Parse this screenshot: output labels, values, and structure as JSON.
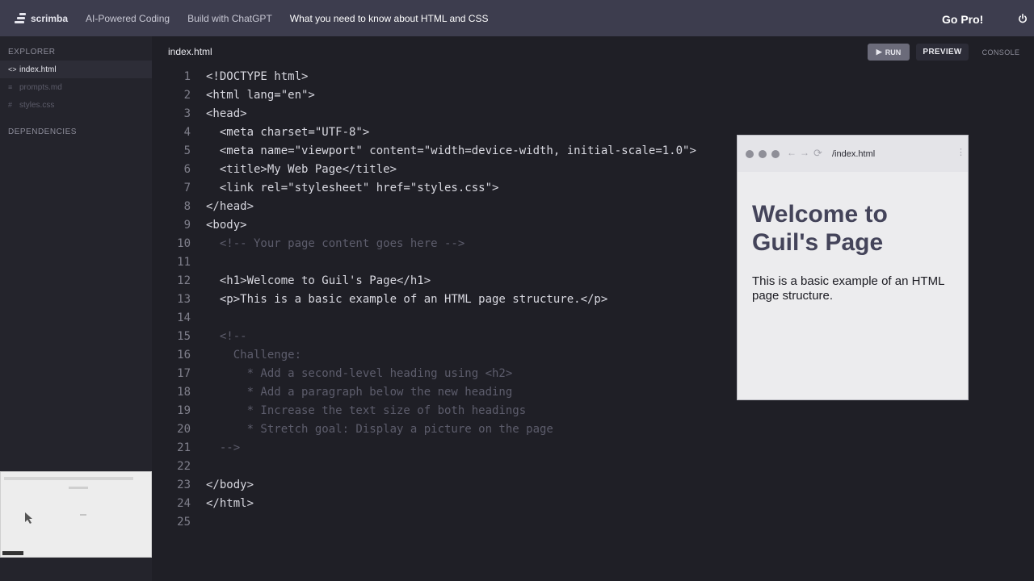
{
  "topbar": {
    "logo": "scrimba",
    "breadcrumbs": [
      "AI-Powered Coding",
      "Build with ChatGPT",
      "What you need to know about HTML and CSS"
    ],
    "go_pro": "Go Pro!"
  },
  "sidebar": {
    "explorer_heading": "EXPLORER",
    "files": [
      {
        "icon": "<>",
        "name": "index.html"
      },
      {
        "icon": "≡",
        "name": "prompts.md"
      },
      {
        "icon": "#",
        "name": "styles.css"
      }
    ],
    "dependencies_heading": "DEPENDENCIES"
  },
  "editor": {
    "filename": "index.html",
    "run_label": "RUN",
    "preview_label": "PREVIEW",
    "console_label": "CONSOLE",
    "lines": [
      {
        "num": "1",
        "text": "<!DOCTYPE html>",
        "comment": false
      },
      {
        "num": "2",
        "text": "<html lang=\"en\">",
        "comment": false
      },
      {
        "num": "3",
        "text": "<head>",
        "comment": false
      },
      {
        "num": "4",
        "text": "  <meta charset=\"UTF-8\">",
        "comment": false
      },
      {
        "num": "5",
        "text": "  <meta name=\"viewport\" content=\"width=device-width, initial-scale=1.0\">",
        "comment": false
      },
      {
        "num": "6",
        "text": "  <title>My Web Page</title>",
        "comment": false
      },
      {
        "num": "7",
        "text": "  <link rel=\"stylesheet\" href=\"styles.css\">",
        "comment": false
      },
      {
        "num": "8",
        "text": "</head>",
        "comment": false
      },
      {
        "num": "9",
        "text": "<body>",
        "comment": false
      },
      {
        "num": "10",
        "text": "  <!-- Your page content goes here -->",
        "comment": true
      },
      {
        "num": "11",
        "text": "",
        "comment": false
      },
      {
        "num": "12",
        "text": "  <h1>Welcome to Guil's Page</h1>",
        "comment": false
      },
      {
        "num": "13",
        "text": "  <p>This is a basic example of an HTML page structure.</p>",
        "comment": false
      },
      {
        "num": "14",
        "text": "",
        "comment": false
      },
      {
        "num": "15",
        "text": "  <!--",
        "comment": true
      },
      {
        "num": "16",
        "text": "    Challenge:",
        "comment": true
      },
      {
        "num": "17",
        "text": "      * Add a second-level heading using <h2>",
        "comment": true
      },
      {
        "num": "18",
        "text": "      * Add a paragraph below the new heading",
        "comment": true
      },
      {
        "num": "19",
        "text": "      * Increase the text size of both headings",
        "comment": true
      },
      {
        "num": "20",
        "text": "      * Stretch goal: Display a picture on the page",
        "comment": true
      },
      {
        "num": "21",
        "text": "  -->",
        "comment": true
      },
      {
        "num": "22",
        "text": "",
        "comment": false
      },
      {
        "num": "23",
        "text": "</body>",
        "comment": false
      },
      {
        "num": "24",
        "text": "</html>",
        "comment": false
      },
      {
        "num": "25",
        "text": "",
        "comment": false
      }
    ]
  },
  "preview": {
    "url": "/index.html",
    "heading": "Welcome to Guil's Page",
    "paragraph": "This is a basic example of an HTML page structure."
  }
}
